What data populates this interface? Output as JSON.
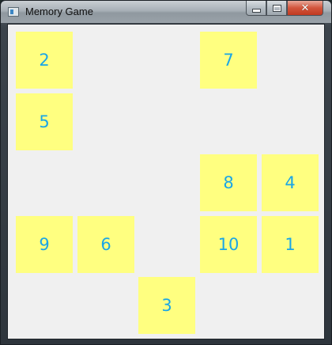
{
  "window": {
    "title": "Memory Game",
    "controls": {
      "minimize": "minimize",
      "maximize": "maximize",
      "close": "✕"
    }
  },
  "colors": {
    "tile_background": "#ffff80",
    "tile_text": "#1aa6e6",
    "board_background": "#f0f0f0"
  },
  "tiles": [
    {
      "label": "2"
    },
    {
      "label": "7"
    },
    {
      "label": "5"
    },
    {
      "label": "8"
    },
    {
      "label": "4"
    },
    {
      "label": "9"
    },
    {
      "label": "6"
    },
    {
      "label": "10"
    },
    {
      "label": "1"
    },
    {
      "label": "3"
    }
  ]
}
